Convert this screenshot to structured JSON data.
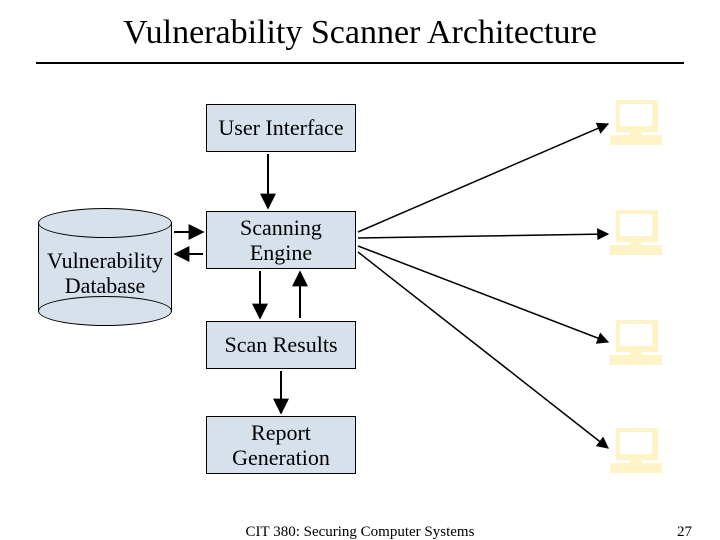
{
  "title": "Vulnerability Scanner Architecture",
  "nodes": {
    "db": "Vulnerability\nDatabase",
    "ui": "User Interface",
    "engine": "Scanning\nEngine",
    "results": "Scan Results",
    "report": "Report\nGeneration"
  },
  "footer": {
    "text": "CIT 380: Securing Computer Systems",
    "page": "27"
  },
  "colors": {
    "box_fill": "#d6e1ec",
    "target_fill": "#fdf3c6"
  }
}
